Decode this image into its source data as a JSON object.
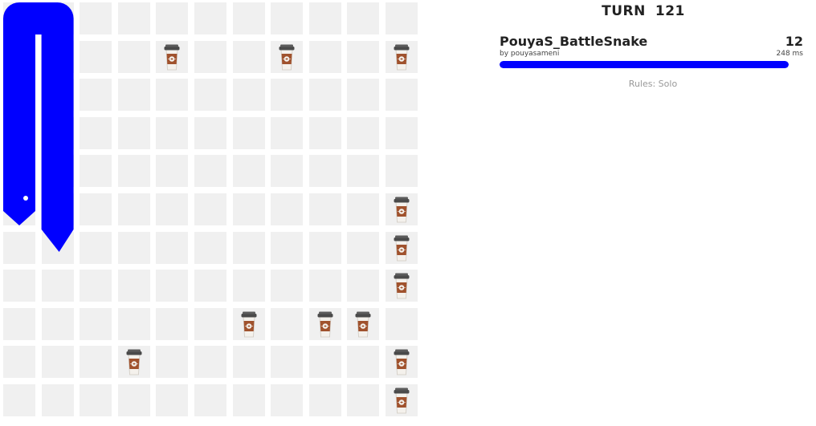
{
  "board": {
    "width": 11,
    "height": 11,
    "cell_color": "#f0f0f0",
    "food": [
      {
        "x": 4,
        "y": 9
      },
      {
        "x": 7,
        "y": 9
      },
      {
        "x": 10,
        "y": 9
      },
      {
        "x": 10,
        "y": 5
      },
      {
        "x": 10,
        "y": 4
      },
      {
        "x": 10,
        "y": 3
      },
      {
        "x": 6,
        "y": 2
      },
      {
        "x": 8,
        "y": 2
      },
      {
        "x": 9,
        "y": 2
      },
      {
        "x": 3,
        "y": 1
      },
      {
        "x": 10,
        "y": 1
      },
      {
        "x": 10,
        "y": 0
      }
    ],
    "snakes": [
      {
        "color": "#0000ff",
        "head": {
          "x": 0,
          "y": 5
        },
        "body": [
          {
            "x": 0,
            "y": 5
          },
          {
            "x": 0,
            "y": 6
          },
          {
            "x": 0,
            "y": 7
          },
          {
            "x": 0,
            "y": 8
          },
          {
            "x": 0,
            "y": 9
          },
          {
            "x": 0,
            "y": 10
          },
          {
            "x": 1,
            "y": 10
          },
          {
            "x": 1,
            "y": 9
          },
          {
            "x": 1,
            "y": 8
          },
          {
            "x": 1,
            "y": 7
          },
          {
            "x": 1,
            "y": 6
          },
          {
            "x": 1,
            "y": 5
          }
        ]
      }
    ]
  },
  "turn": {
    "label": "TURN",
    "value": "121"
  },
  "snake_card": {
    "name": "PouyaS_BattleSnake",
    "author": "by pouyasameni",
    "length": "12",
    "latency": "248 ms",
    "health": 1.0,
    "color": "#0000ff"
  },
  "rules": "Rules: Solo"
}
